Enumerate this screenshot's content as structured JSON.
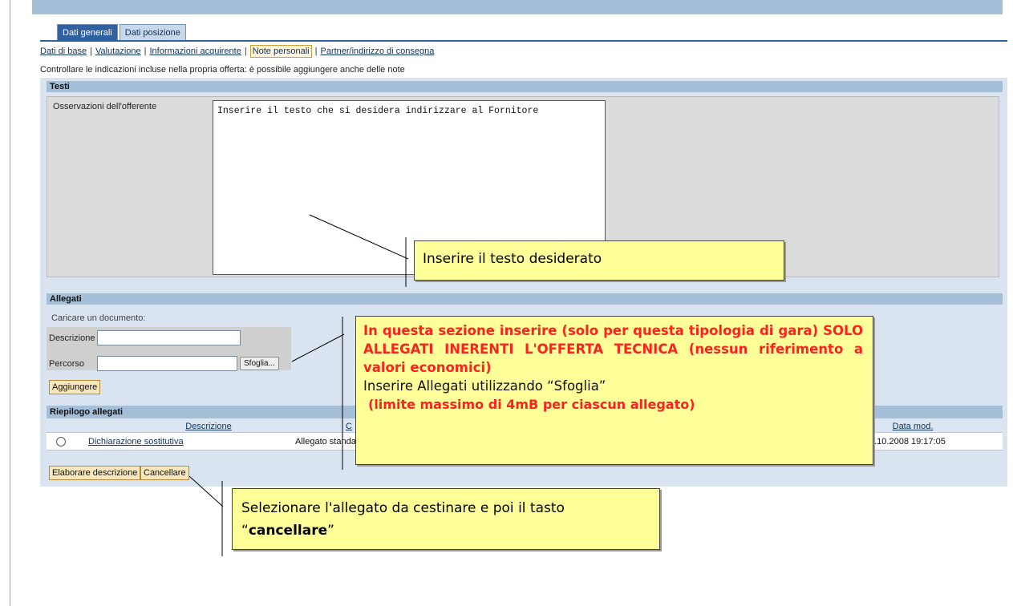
{
  "tabs": [
    {
      "label": "Dati generali",
      "active": true
    },
    {
      "label": "Dati posizione",
      "active": false
    }
  ],
  "subnav": {
    "items": [
      "Dati di base",
      "Valutazione",
      "Informazioni acquirente",
      "Note personali",
      "Partner/indirizzo di consegna"
    ],
    "current": "Note personali"
  },
  "hint": "Controllare le indicazioni incluse nella propria offerta: è possibile aggiungere anche delle note",
  "testi": {
    "header": "Testi",
    "label": "Osservazioni dell'offerente",
    "textarea_value": "Inserire il testo che si desidera indirizzare al Fornitore"
  },
  "allegati": {
    "header": "Allegati",
    "upload_label": "Caricare un documento:",
    "descrizione_label": "Descrizione",
    "descrizione_value": "",
    "percorso_label": "Percorso",
    "percorso_value": "",
    "browse_button": "Sfoglia...",
    "add_button": "Aggiungere"
  },
  "riepilogo": {
    "header": "Riepilogo allegati",
    "columns": [
      "Descrizione",
      "C",
      "Data mod."
    ],
    "rows": [
      {
        "descrizione": "Dichiarazione sostitutiva",
        "tipo": "Allegato standa",
        "data_mod": "4.10.2008 19:17:05"
      }
    ],
    "edit_button": "Elaborare descrizione",
    "delete_button": "Cancellare"
  },
  "callouts": {
    "text_hint": "Inserire il testo desiderato",
    "attach_red": "In questa sezione inserire (solo per questa tipologia di gara) SOLO ALLEGATI INERENTI L'OFFERTA TECNICA (nessun riferimento a valori economici)",
    "attach_normal": "Inserire Allegati utilizzando “Sfoglia”",
    "attach_limit": "(limite massimo di 4mB per ciascun allegato)",
    "delete_pre": "Selezionare l'allegato da cestinare e poi il tasto “",
    "delete_bold": "cancellare",
    "delete_post": "”"
  },
  "colors": {
    "tab_active": "#2f61a3",
    "section_header": "#a6bfd9",
    "callout_bg": "#ffff99",
    "button_bg": "#f8e7bd",
    "warning_red": "#ff2020"
  }
}
